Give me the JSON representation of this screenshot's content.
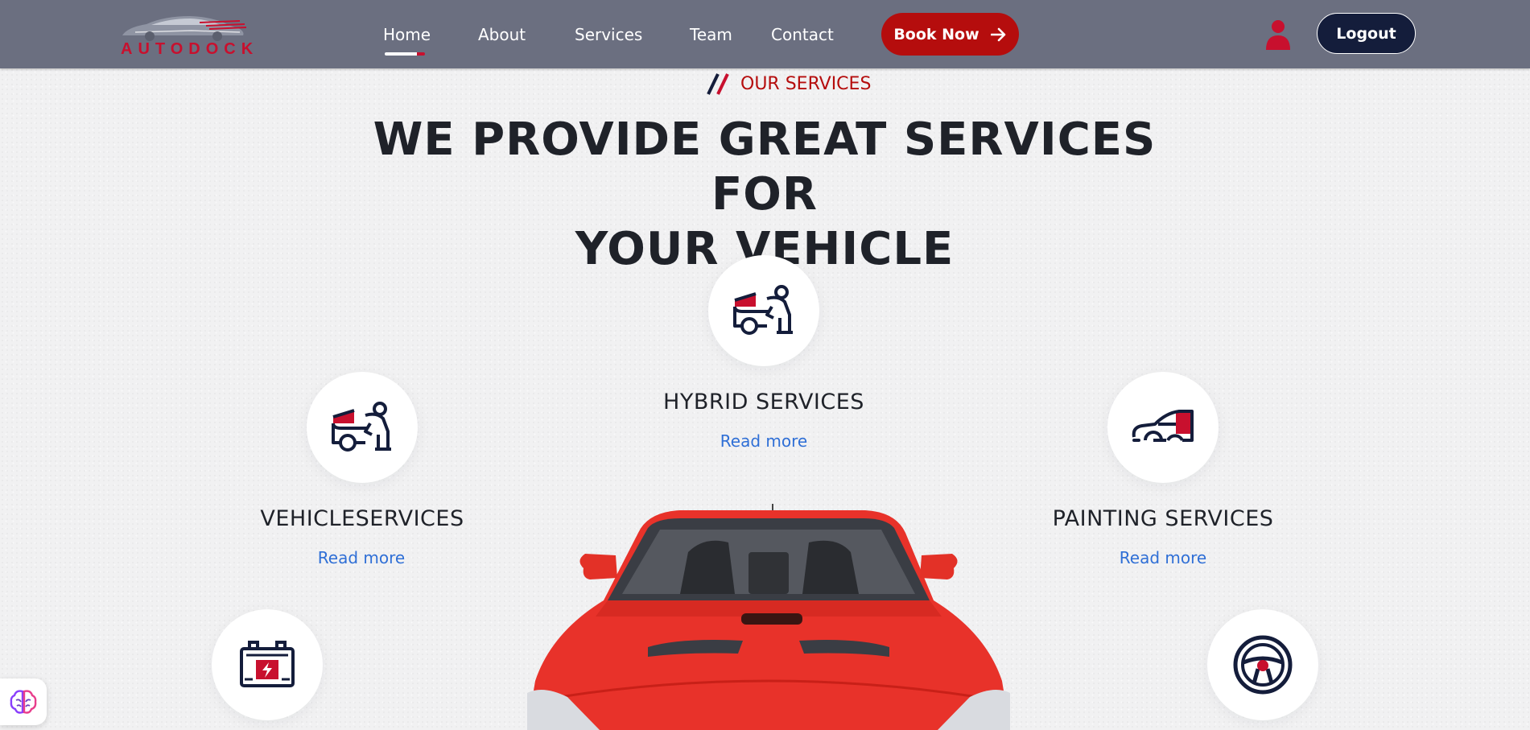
{
  "brand": {
    "logo_text": "AUTODOCK"
  },
  "nav": {
    "items": [
      {
        "label": "Home",
        "active": true
      },
      {
        "label": "About"
      },
      {
        "label": "Services"
      },
      {
        "label": "Team"
      },
      {
        "label": "Contact"
      }
    ],
    "book_label": "Book Now",
    "logout_label": "Logout"
  },
  "services": {
    "eyebrow": "OUR SERVICES",
    "heading_line1": "WE PROVIDE GREAT SERVICES FOR",
    "heading_line2": "YOUR VEHICLE",
    "items": [
      {
        "title": "HYBRID SERVICES",
        "link": "Read more",
        "icon": "mechanic-car-icon"
      },
      {
        "title": "VEHICLESERVICES",
        "link": "Read more",
        "icon": "mechanic-car-icon"
      },
      {
        "title": "PAINTING SERVICES",
        "link": "Read more",
        "icon": "car-paint-icon"
      }
    ],
    "bottom_icons": [
      "battery-icon",
      "steering-wheel-icon"
    ]
  },
  "colors": {
    "navbar": "#6b6f80",
    "accent_red": "#b50d0d",
    "navy": "#141d3b",
    "link_blue": "#2f6fd6",
    "heading": "#1f2229"
  }
}
